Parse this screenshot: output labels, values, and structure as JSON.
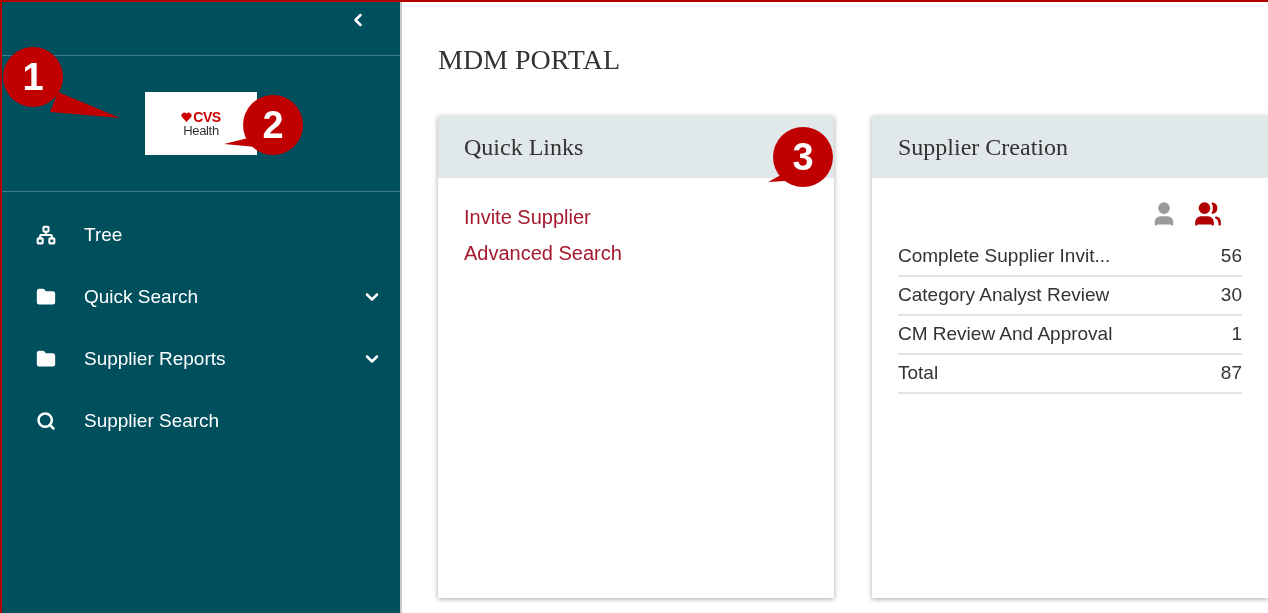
{
  "sidebar": {
    "logo": {
      "mark": "CVS",
      "text": "Health"
    },
    "items": [
      {
        "kind": "tree",
        "label": "Tree",
        "submenu": false
      },
      {
        "kind": "folder",
        "label": "Quick Search",
        "submenu": true
      },
      {
        "kind": "folder",
        "label": "Supplier Reports",
        "submenu": true
      },
      {
        "kind": "search",
        "label": "Supplier Search",
        "submenu": false
      }
    ]
  },
  "page_title": "MDM PORTAL",
  "quick_links": {
    "title": "Quick Links",
    "links": [
      "Invite Supplier",
      "Advanced Search"
    ]
  },
  "supplier_creation": {
    "title": "Supplier Creation",
    "views": [
      {
        "kind": "single",
        "selected": false
      },
      {
        "kind": "group",
        "selected": true
      }
    ],
    "rows": [
      {
        "label": "Complete Supplier Invit...",
        "count": "56"
      },
      {
        "label": "Category Analyst Review",
        "count": "30"
      },
      {
        "label": "CM Review And Approval",
        "count": "1"
      },
      {
        "label": "Total",
        "count": "87"
      }
    ]
  },
  "callouts": [
    {
      "label": "1"
    },
    {
      "label": "2"
    },
    {
      "label": "3"
    }
  ]
}
